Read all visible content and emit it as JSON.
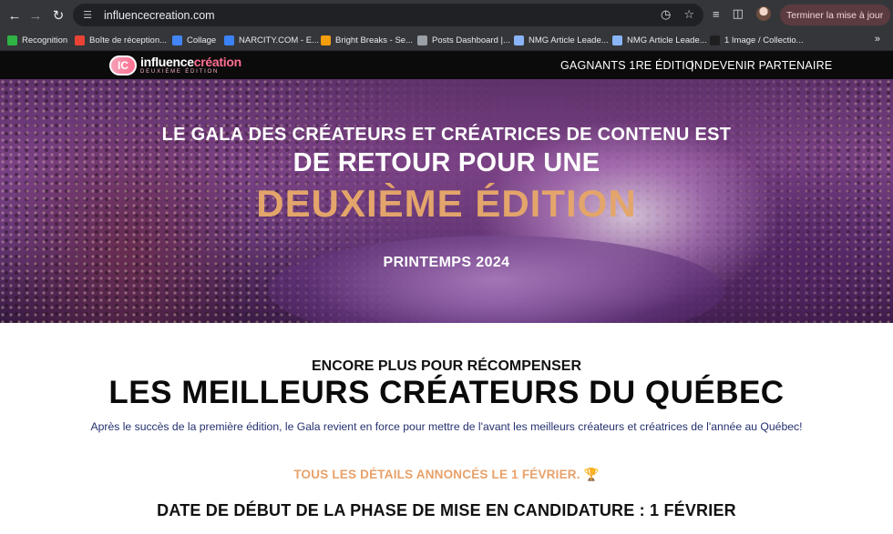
{
  "browser": {
    "url": "influencecreation.com",
    "update_button": "Terminer la mise à jour"
  },
  "bookmarks": [
    {
      "label": "Recognition",
      "color": "#2fb344"
    },
    {
      "label": "Boîte de réception...",
      "color": "#ea4335"
    },
    {
      "label": "Collage",
      "color": "#4285f4"
    },
    {
      "label": "NARCITY.COM - E...",
      "color": "#3b82f6"
    },
    {
      "label": "Bright Breaks - Se...",
      "color": "#f59e0b"
    },
    {
      "label": "Posts Dashboard |...",
      "color": "#9aa0a6"
    },
    {
      "label": "NMG Article Leade...",
      "color": "#8ab4f8"
    },
    {
      "label": "NMG Article Leade...",
      "color": "#8ab4f8"
    },
    {
      "label": "1 Image / Collectio...",
      "color": "#1f1f1f"
    }
  ],
  "site_header": {
    "logo": {
      "word1": "influence",
      "word2": "création",
      "tagline": "DEUXIÈME ÉDITION",
      "mark": "IC"
    },
    "nav": {
      "winners": "GAGNANTS 1RE ÉDITION",
      "separator": "|",
      "partner": "DEVENIR PARTENAIRE"
    }
  },
  "hero": {
    "line1": "LE GALA DES CRÉATEURS ET CRÉATRICES DE CONTENU EST",
    "line2": "DE RETOUR POUR UNE",
    "line3": "DEUXIÈME ÉDITION",
    "line4": "PRINTEMPS 2024"
  },
  "content": {
    "kicker": "ENCORE PLUS POUR RÉCOMPENSER",
    "headline": "LES MEILLEURS CRÉATEURS DU QUÉBEC",
    "description": "Après le succès de la première édition, le Gala revient en force pour mettre de l'avant les meilleurs créateurs et créatrices de l'année au Québec!",
    "details": "TOUS LES DÉTAILS ANNONCÉS LE 1 FÉVRIER. 🏆",
    "candidacy": "DATE DE DÉBUT DE LA PHASE DE MISE EN CANDIDATURE : 1 FÉVRIER"
  },
  "colors": {
    "accent_gold": "#e3a56b",
    "brand_pink": "#ff6f91",
    "text_navy": "#24306e"
  }
}
